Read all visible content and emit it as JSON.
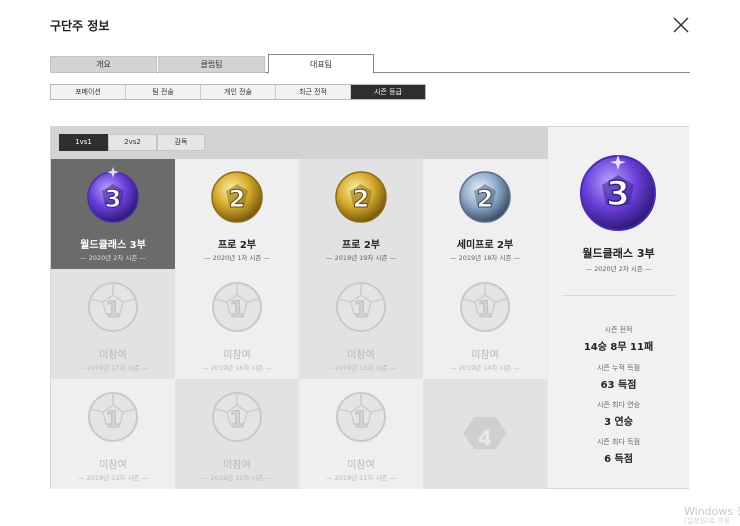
{
  "window": {
    "title": "구단주 정보"
  },
  "tabs": [
    {
      "label": "개요"
    },
    {
      "label": "클럽팀"
    },
    {
      "label": "대표팀"
    }
  ],
  "subtabs": [
    {
      "label": "포메이션"
    },
    {
      "label": "팀 전술"
    },
    {
      "label": "개인 전술"
    },
    {
      "label": "최근 전적"
    },
    {
      "label": "시즌 등급"
    }
  ],
  "modes": [
    {
      "label": "1vs1"
    },
    {
      "label": "2vs2"
    },
    {
      "label": "감독"
    }
  ],
  "seasons": [
    {
      "rank": "월드클래스 3부",
      "season": "— 2020년 2차 시즌 —",
      "badge": "purple-3",
      "digit": "3"
    },
    {
      "rank": "프로 2부",
      "season": "— 2020년 1차 시즌 —",
      "badge": "gold-2",
      "digit": "2"
    },
    {
      "rank": "프로 2부",
      "season": "— 2019년 19차 시즌 —",
      "badge": "gold-2",
      "digit": "2"
    },
    {
      "rank": "세미프로 2부",
      "season": "— 2019년 18차 시즌 —",
      "badge": "silver-2",
      "digit": "2"
    },
    {
      "rank": "미참여",
      "season": "— 2019년 17차 시즌 —",
      "badge": "empty-1",
      "digit": "1"
    },
    {
      "rank": "미참여",
      "season": "— 2019년 16차 시즌 —",
      "badge": "empty-1",
      "digit": "1"
    },
    {
      "rank": "미참여",
      "season": "— 2019년 15차 시즌 —",
      "badge": "empty-1",
      "digit": "1"
    },
    {
      "rank": "미참여",
      "season": "— 2019년 14차 시즌 —",
      "badge": "empty-1",
      "digit": "1"
    },
    {
      "rank": "미참여",
      "season": "— 2019년 13차 시즌 —",
      "badge": "empty-1",
      "digit": "1"
    },
    {
      "rank": "미참여",
      "season": "— 2019년 12차 시즌 —",
      "badge": "empty-1",
      "digit": "1"
    },
    {
      "rank": "미참여",
      "season": "— 2019년 11차 시즌 —",
      "badge": "empty-1",
      "digit": "1"
    },
    {
      "rank": "",
      "season": "",
      "badge": "locked-4",
      "digit": "4"
    }
  ],
  "current": {
    "rank": "월드클래스 3부",
    "season": "— 2020년 2차 시즌 —",
    "digit": "3",
    "stats": [
      {
        "label": "시즌 전적",
        "value": "14승 8무 11패"
      },
      {
        "label": "시즌 누적 득점",
        "value": "63 득점"
      },
      {
        "label": "시즌 최다 연승",
        "value": "3 연승"
      },
      {
        "label": "시즌 최다 득점",
        "value": "6 득점"
      }
    ]
  },
  "watermark": {
    "line1": "Windows 정",
    "line2": "[설정]으로 이동"
  },
  "colors": {
    "accent_dark": "#2f2f2f",
    "selected_cell": "#6b6b6b",
    "purple": "#7b52e8",
    "gold": "#c9a227",
    "silver": "#8fa8c8"
  }
}
